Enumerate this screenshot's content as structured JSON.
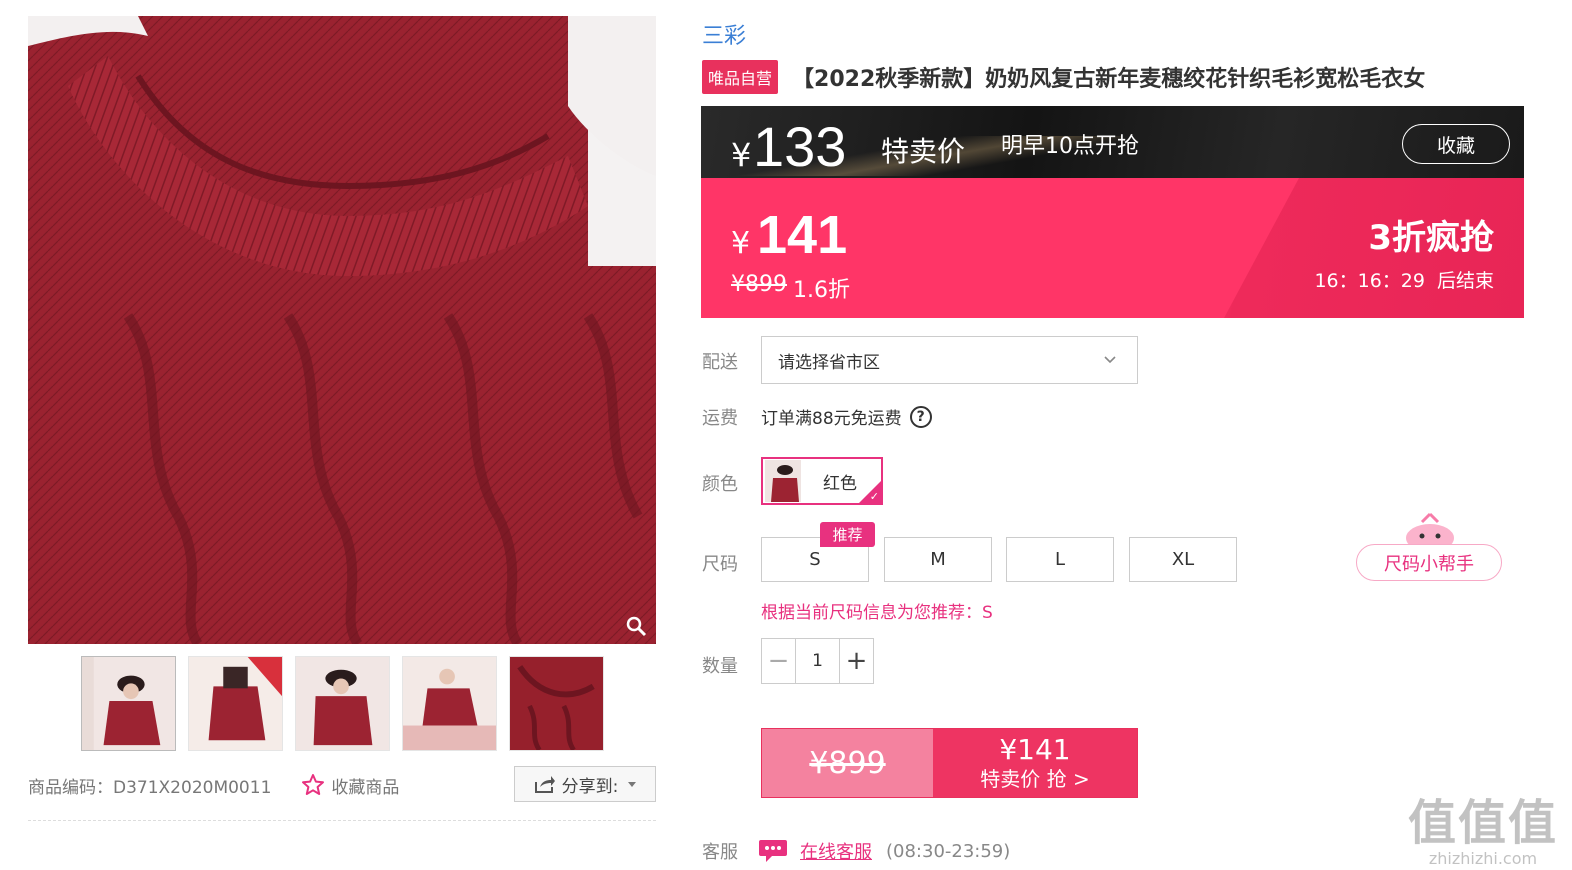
{
  "product": {
    "brand": "三彩",
    "badge": "唯品自营",
    "title": "【2022秋季新款】奶奶风复古新年麦穗绞花针织毛衫宽松毛衣女",
    "code_label": "商品编码：D371X2020M0011",
    "favorite_label": "收藏商品",
    "share_label": "分享到:"
  },
  "promo": {
    "sale_currency": "¥",
    "sale_price": "133",
    "sale_label": "特卖价",
    "sale_time": "明早10点开抢",
    "collect_label": "收藏",
    "current_currency": "¥",
    "current_price": "141",
    "original_price": "¥899",
    "discount": "1.6折",
    "flash_label": "3折疯抢",
    "countdown": [
      "16：16：29",
      "后结束"
    ]
  },
  "options": {
    "delivery_label": "配送",
    "region_placeholder": "请选择省市区",
    "freight_label": "运费",
    "freight_text": "订单满88元免运费",
    "help_symbol": "?",
    "color_label": "颜色",
    "color_selected": "红色",
    "size_label": "尺码",
    "sizes": [
      "S",
      "M",
      "L",
      "XL"
    ],
    "recommended_badge": "推荐",
    "size_helper": "尺码小帮手",
    "size_recommendation": "根据当前尺码信息为您推荐：S",
    "quantity_label": "数量",
    "quantity": "1"
  },
  "buy": {
    "original_price": "¥899",
    "price": "¥141",
    "action": "特卖价 抢 >"
  },
  "service": {
    "label": "客服",
    "link": "在线客服",
    "hours": "(08:30-23:59)"
  },
  "watermark": {
    "big": "值值值",
    "small": "zhizhizhi.com"
  },
  "colors": {
    "accent_pink": "#ff3567",
    "brand_blue": "#3b7fd5",
    "sweater_red": "#96202c"
  }
}
